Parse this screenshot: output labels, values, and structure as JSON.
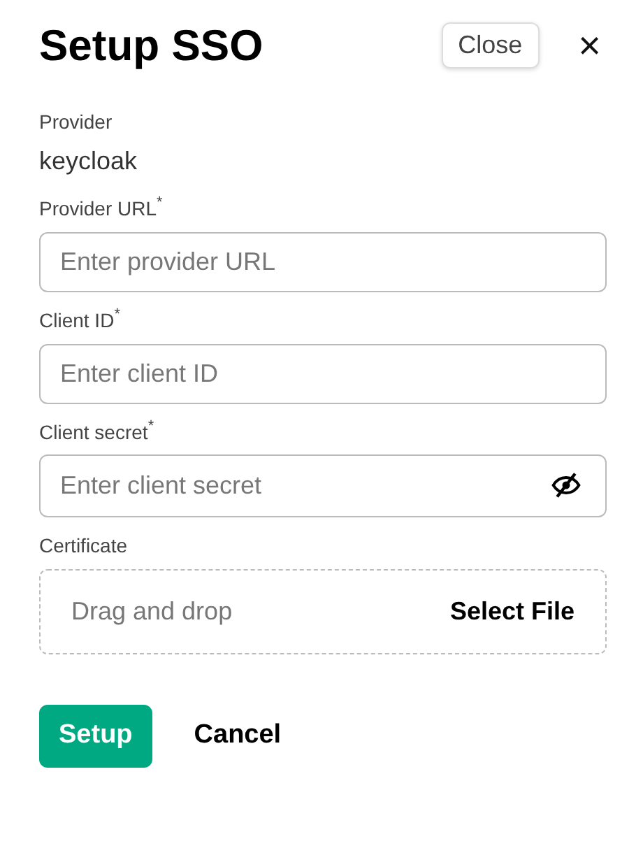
{
  "dialog": {
    "title": "Setup SSO",
    "close_button": "Close",
    "close_icon": "×"
  },
  "provider": {
    "label": "Provider",
    "value": "keycloak"
  },
  "fields": [
    {
      "kind": "text",
      "label": "Provider URL$^{*}$",
      "placeholder": "Enter provider URL"
    },
    {
      "kind": "text",
      "label": "Client ID$^{*}$",
      "placeholder": "Enter client ID"
    },
    {
      "kind": "secret",
      "label": "Client secret$^{*}$",
      "placeholder": "Enter client secret"
    },
    {
      "kind": "file",
      "label": "Certificate",
      "hint": "Drag and drop",
      "action": "Select File"
    }
  ],
  "buttons": [
    {
      "kind": "primary",
      "label": "Setup"
    },
    {
      "kind": "plain",
      "label": "Cancel"
    }
  ]
}
